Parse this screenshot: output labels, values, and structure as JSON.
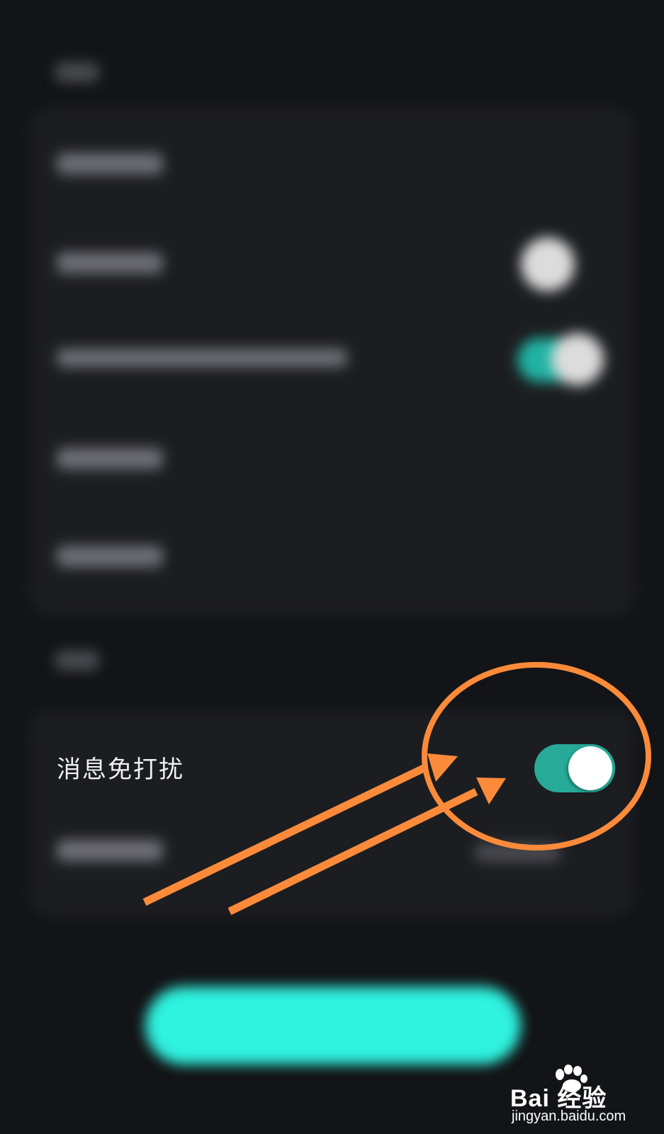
{
  "setting": {
    "label": "消息免打扰",
    "enabled": true
  },
  "watermark": {
    "brand": "Bai 经验",
    "url": "jingyan.baidu.com"
  },
  "colors": {
    "background": "#131417",
    "card": "#1c1d21",
    "toggle_on": "#27aa98",
    "annotation": "#fb8b3a",
    "primary_button": "#2ff2df"
  },
  "icons": {
    "watermark_logo": "paw-icon"
  }
}
